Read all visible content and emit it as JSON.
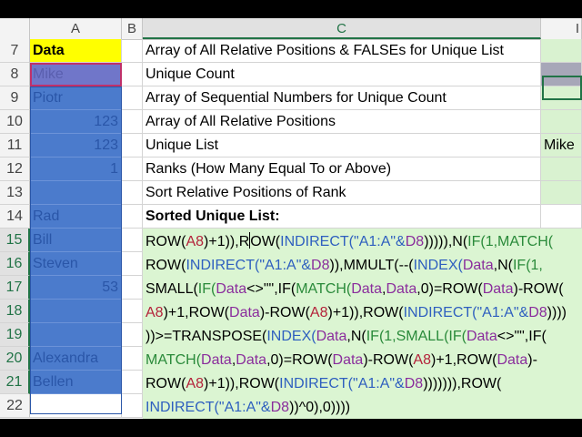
{
  "columns": [
    "A",
    "B",
    "C",
    "I"
  ],
  "active_column": "C",
  "rows": [
    {
      "num": "7",
      "a": "Data",
      "c": "Array of All Relative Positions & FALSEs for Unique List",
      "i": ""
    },
    {
      "num": "8",
      "a": "Mike",
      "c": "Unique Count",
      "i": ""
    },
    {
      "num": "9",
      "a": "Piotr",
      "c": "Array of Sequential Numbers for Unique Count",
      "i": ""
    },
    {
      "num": "10",
      "a": "123",
      "c": "Array of All Relative Positions",
      "i": ""
    },
    {
      "num": "11",
      "a": "123",
      "c": "Unique List",
      "i": "Mike"
    },
    {
      "num": "12",
      "a": "1",
      "c": "Ranks (How Many Equal To or Above)",
      "i": ""
    },
    {
      "num": "13",
      "a": "",
      "c": "Sort Relative Positions of Rank",
      "i": ""
    },
    {
      "num": "14",
      "a": "Rad",
      "c": "Sorted Unique List:",
      "i": ""
    },
    {
      "num": "15",
      "a": "Bill",
      "c": "",
      "i": ""
    },
    {
      "num": "16",
      "a": "Steven",
      "c": "",
      "i": ""
    },
    {
      "num": "17",
      "a": "53",
      "c": "",
      "i": ""
    },
    {
      "num": "18",
      "a": "",
      "c": "",
      "i": ""
    },
    {
      "num": "19",
      "a": "",
      "c": "",
      "i": ""
    },
    {
      "num": "20",
      "a": "Alexandra",
      "c": "",
      "i": ""
    },
    {
      "num": "21",
      "a": "Bellen",
      "c": "",
      "i": ""
    },
    {
      "num": "22",
      "a": "",
      "c": "",
      "i": ""
    }
  ],
  "formula_lines": [
    [
      [
        "ROW(",
        "black"
      ],
      [
        "A8",
        "red"
      ],
      [
        ")+1)),R",
        "black"
      ],
      [
        "|",
        "cursor"
      ],
      [
        "OW(",
        "black"
      ],
      [
        "INDIRECT(\"A1:A\"&",
        "blue"
      ],
      [
        "D8",
        "purple"
      ],
      [
        "))))),N(",
        "black"
      ],
      [
        "IF(1,MATCH(",
        "green"
      ]
    ],
    [
      [
        "ROW(",
        "black"
      ],
      [
        "INDIRECT(\"A1:A\"&",
        "blue"
      ],
      [
        "D8",
        "purple"
      ],
      [
        ")),MMULT(--(",
        "black"
      ],
      [
        "INDEX(",
        "blue"
      ],
      [
        "Data",
        "purple"
      ],
      [
        ",N(",
        "black"
      ],
      [
        "IF(1,",
        "green"
      ]
    ],
    [
      [
        "SMALL(",
        "black"
      ],
      [
        "IF(",
        "green"
      ],
      [
        "Data",
        "purple"
      ],
      [
        "<>\"\",IF(",
        "black"
      ],
      [
        "MATCH(",
        "green"
      ],
      [
        "Data",
        "purple"
      ],
      [
        ",",
        "black"
      ],
      [
        "Data",
        "purple"
      ],
      [
        ",0)=ROW(",
        "black"
      ],
      [
        "Data",
        "purple"
      ],
      [
        ")-ROW(",
        "black"
      ]
    ],
    [
      [
        "A8",
        "red"
      ],
      [
        ")+1,ROW(",
        "black"
      ],
      [
        "Data",
        "purple"
      ],
      [
        ")-ROW(",
        "black"
      ],
      [
        "A8",
        "red"
      ],
      [
        ")+1)),ROW(",
        "black"
      ],
      [
        "INDIRECT(\"A1:A\"&",
        "blue"
      ],
      [
        "D8",
        "purple"
      ],
      [
        "))))",
        "black"
      ]
    ],
    [
      [
        "))>=TRANSPOSE(",
        "black"
      ],
      [
        "INDEX(",
        "blue"
      ],
      [
        "Data",
        "purple"
      ],
      [
        ",N(",
        "black"
      ],
      [
        "IF(1,SMALL(IF(",
        "green"
      ],
      [
        "Data",
        "purple"
      ],
      [
        "<>\"\",IF(",
        "black"
      ]
    ],
    [
      [
        "MATCH(",
        "green"
      ],
      [
        "Data",
        "purple"
      ],
      [
        ",",
        "black"
      ],
      [
        "Data",
        "purple"
      ],
      [
        ",0)=ROW(",
        "black"
      ],
      [
        "Data",
        "purple"
      ],
      [
        ")-ROW(",
        "black"
      ],
      [
        "A8",
        "red"
      ],
      [
        ")+1,ROW(",
        "black"
      ],
      [
        "Data",
        "purple"
      ],
      [
        ")-",
        "black"
      ]
    ],
    [
      [
        "ROW(",
        "black"
      ],
      [
        "A8",
        "red"
      ],
      [
        ")+1)),ROW(",
        "black"
      ],
      [
        "INDIRECT(\"A1:A\"&",
        "blue"
      ],
      [
        "D8",
        "purple"
      ],
      [
        "))))))),ROW(",
        "black"
      ]
    ],
    [
      [
        "INDIRECT(\"A1:A\"&",
        "blue"
      ],
      [
        "D8",
        "purple"
      ],
      [
        "))^0),0))))",
        "black"
      ]
    ]
  ],
  "colors": {
    "selection": "#4b7bcc",
    "header_yellow": "#ffff00",
    "formula_bg": "#dbf5d2",
    "excel_green": "#217346"
  }
}
